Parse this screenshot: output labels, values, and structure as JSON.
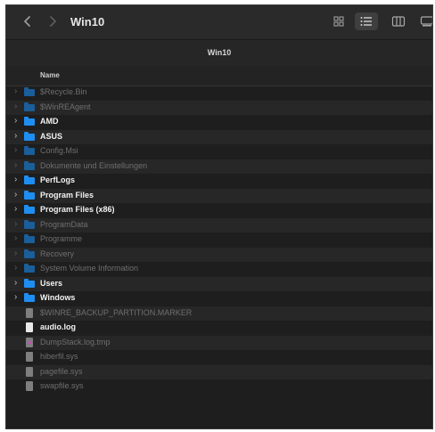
{
  "window": {
    "title": "Win10",
    "path_title": "Win10"
  },
  "toolbar": {
    "back_icon": "chevron-left-icon",
    "forward_icon": "chevron-right-icon",
    "views": [
      "grid-view-icon",
      "list-view-icon",
      "column-view-icon",
      "gallery-view-icon"
    ],
    "active_view": "list"
  },
  "list": {
    "header_name": "Name",
    "items": [
      {
        "name": "$Recycle.Bin",
        "kind": "folder",
        "hidden": true,
        "expandable": true
      },
      {
        "name": "$WinREAgent",
        "kind": "folder",
        "hidden": true,
        "expandable": true
      },
      {
        "name": "AMD",
        "kind": "folder",
        "hidden": false,
        "expandable": true
      },
      {
        "name": "ASUS",
        "kind": "folder",
        "hidden": false,
        "expandable": true
      },
      {
        "name": "Config.Msi",
        "kind": "folder",
        "hidden": true,
        "expandable": true
      },
      {
        "name": "Dokumente und Einstellungen",
        "kind": "folder",
        "hidden": true,
        "expandable": true
      },
      {
        "name": "PerfLogs",
        "kind": "folder",
        "hidden": false,
        "expandable": true
      },
      {
        "name": "Program Files",
        "kind": "folder",
        "hidden": false,
        "expandable": true
      },
      {
        "name": "Program Files (x86)",
        "kind": "folder",
        "hidden": false,
        "expandable": true
      },
      {
        "name": "ProgramData",
        "kind": "folder",
        "hidden": true,
        "expandable": true
      },
      {
        "name": "Programme",
        "kind": "folder",
        "hidden": true,
        "expandable": true
      },
      {
        "name": "Recovery",
        "kind": "folder",
        "hidden": true,
        "expandable": true
      },
      {
        "name": "System Volume Information",
        "kind": "folder",
        "hidden": true,
        "expandable": true
      },
      {
        "name": "Users",
        "kind": "folder",
        "hidden": false,
        "expandable": true
      },
      {
        "name": "Windows",
        "kind": "folder",
        "hidden": false,
        "expandable": true
      },
      {
        "name": "$WINRE_BACKUP_PARTITION.MARKER",
        "kind": "file",
        "hidden": true,
        "expandable": false
      },
      {
        "name": "audio.log",
        "kind": "file",
        "hidden": false,
        "expandable": false
      },
      {
        "name": "DumpStack.log.tmp",
        "kind": "file-tmp",
        "hidden": true,
        "expandable": false
      },
      {
        "name": "hiberfil.sys",
        "kind": "file",
        "hidden": true,
        "expandable": false
      },
      {
        "name": "pagefile.sys",
        "kind": "file",
        "hidden": true,
        "expandable": false
      },
      {
        "name": "swapfile.sys",
        "kind": "file",
        "hidden": true,
        "expandable": false
      }
    ]
  },
  "colors": {
    "folder": "#1e8ef3",
    "background": "#1e1e1e",
    "row_alt": "#272727"
  }
}
